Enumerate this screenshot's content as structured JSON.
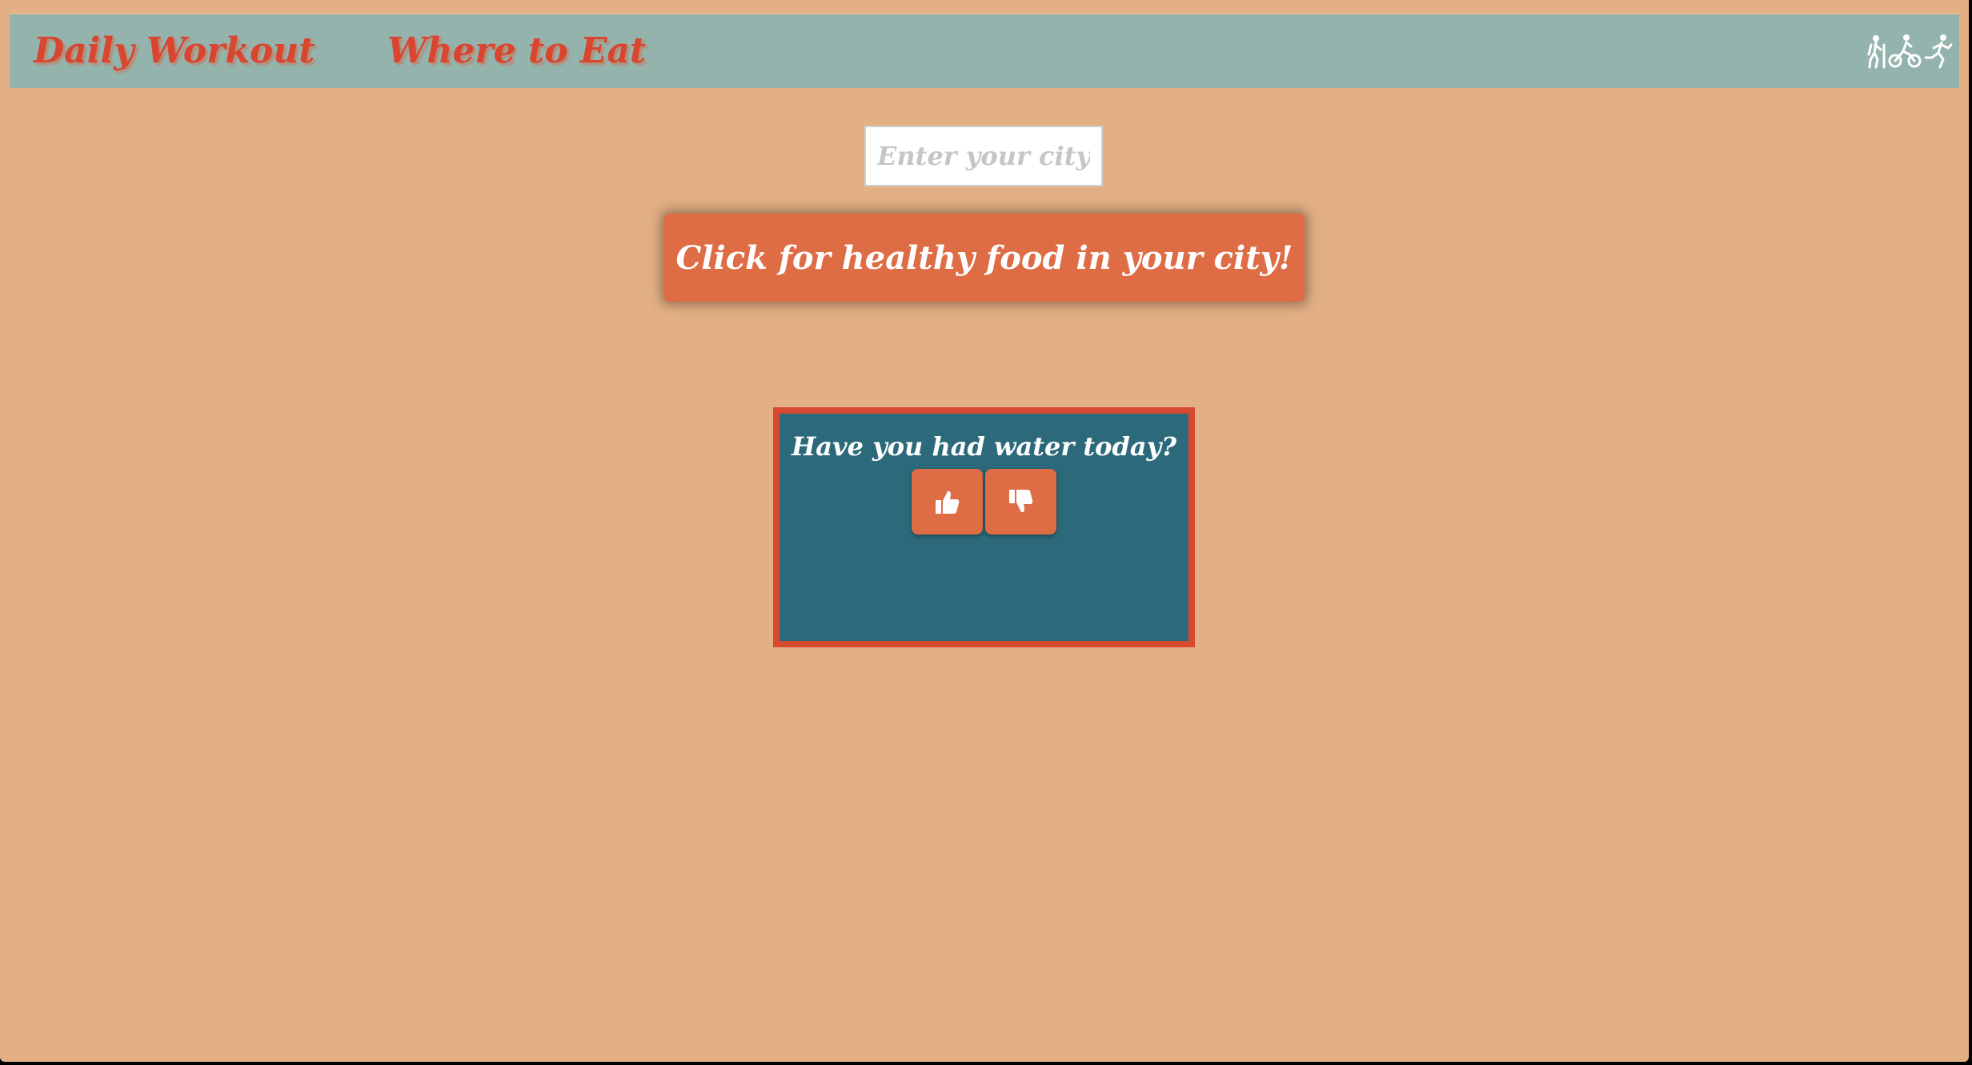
{
  "nav": {
    "workout_label": "Daily Workout",
    "eat_label": "Where to Eat",
    "icons": [
      "hiking-icon",
      "cycling-icon",
      "running-icon"
    ]
  },
  "search": {
    "placeholder": "Enter your city",
    "value": ""
  },
  "food_button": {
    "label": "Click for healthy food in your city!"
  },
  "water_card": {
    "question": "Have you had water today?",
    "buttons": [
      "thumbs-up-icon",
      "thumbs-down-icon"
    ]
  },
  "colors": {
    "page_background": "#e2b084",
    "navbar": "#94b3ad",
    "accent": "#de6c45",
    "nav_text": "#d9452f",
    "card_background": "#2c6a7b",
    "card_border": "#d84a2f"
  }
}
